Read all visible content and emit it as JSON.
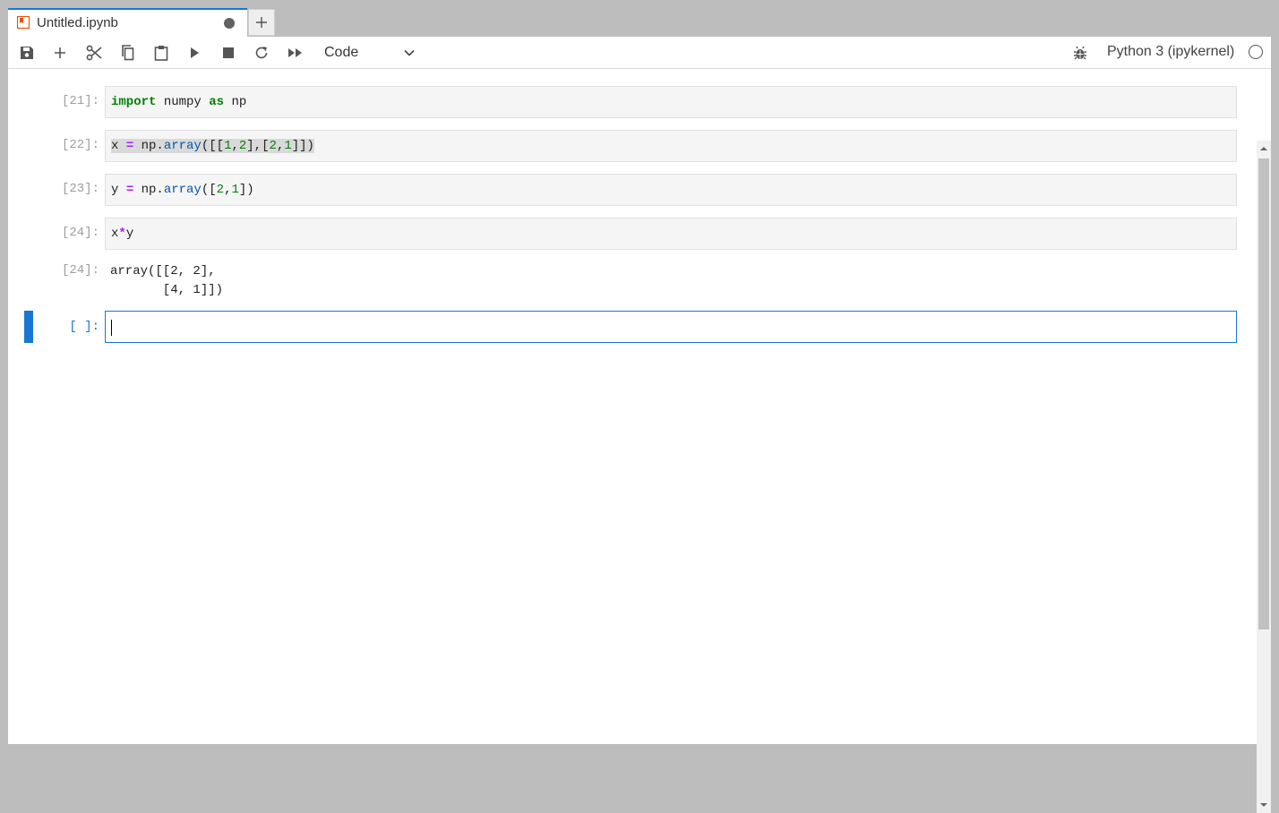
{
  "tab": {
    "title": "Untitled.ipynb",
    "icon": "notebook-icon",
    "unsaved": true,
    "accent": "#1976d2"
  },
  "toolbar": {
    "icons": [
      "save-icon",
      "add-icon",
      "cut-icon",
      "copy-icon",
      "paste-icon",
      "run-icon",
      "stop-icon",
      "restart-icon",
      "fast-forward-icon"
    ],
    "cell_type": "Code",
    "kernel_name": "Python 3 (ipykernel)"
  },
  "cells": [
    {
      "prompt": "[21]:",
      "code": "import numpy as np"
    },
    {
      "prompt": "[22]:",
      "code": "x = np.array([[1,2],[2,1]])"
    },
    {
      "prompt": "[23]:",
      "code": "y = np.array([2,1])"
    },
    {
      "prompt": "[24]:",
      "code": "x*y"
    }
  ],
  "output": {
    "prompt": "[24]:",
    "line1": "array([[2, 2],",
    "line2": "       [4, 1]])"
  },
  "active_cell": {
    "prompt": "[ ]:",
    "code": ""
  }
}
